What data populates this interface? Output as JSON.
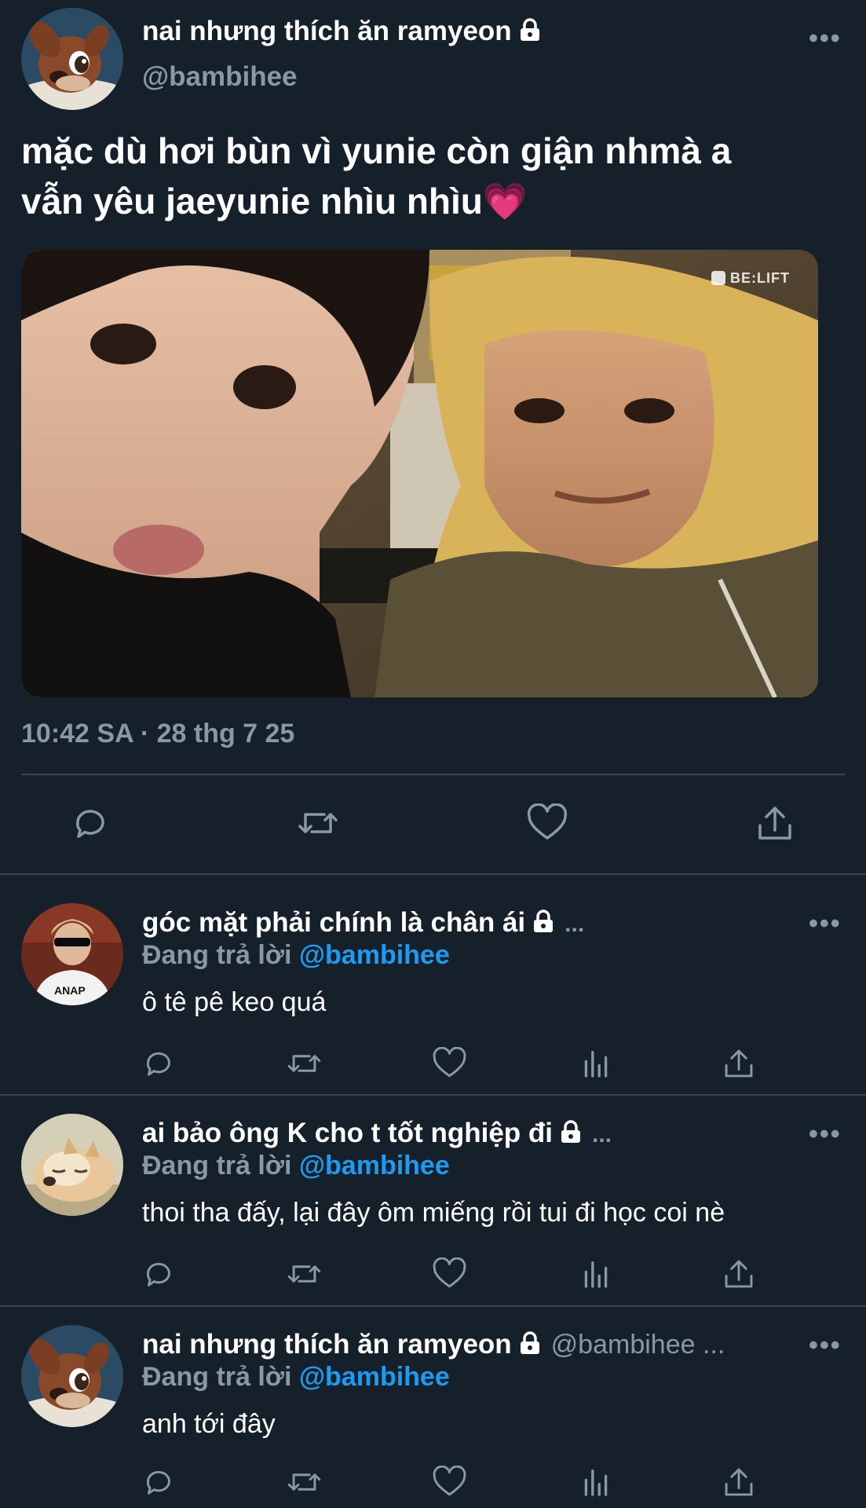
{
  "main_tweet": {
    "display_name": "nai nhưng thích ăn ramyeon",
    "handle": "@bambihee",
    "text_line1": "mặc dù hơi bùn vì yunie còn giận nhmà a",
    "text_line2": "vẫn yêu jaeyunie nhìu nhìu💗",
    "watermark": "BE:LIFT",
    "timestamp": "10:42 SA · 28 thg 7 25",
    "more": "•••"
  },
  "replies": [
    {
      "display_name": "góc mặt phải chính là chân ái",
      "ellipsis": "...",
      "replying_prefix": "Đang trả lời ",
      "replying_handle": "@bambihee",
      "text": "ô tê pê keo quá",
      "shirt_text": "ANAP",
      "more": "•••"
    },
    {
      "display_name": "ai bảo ông K cho t tốt nghiệp đi",
      "ellipsis": "...",
      "replying_prefix": "Đang trả lời ",
      "replying_handle": "@bambihee",
      "text": "thoi tha đấy, lại đây ôm miếng rồi tui đi học coi nè",
      "more": "•••"
    },
    {
      "display_name": "nai nhưng thích ăn ramyeon",
      "handle_inline": "@bambihee ...",
      "replying_prefix": "Đang trả lời ",
      "replying_handle": "@bambihee",
      "text": "anh tới đây",
      "more": "•••"
    }
  ],
  "icons": {
    "reply": "reply-icon",
    "retweet": "retweet-icon",
    "like": "heart-icon",
    "share": "share-icon",
    "views": "analytics-icon",
    "lock": "lock-icon"
  },
  "colors": {
    "background": "#15202b",
    "text": "#ffffff",
    "muted": "#8899a6",
    "link": "#1d9bf0",
    "divider": "#38444d"
  }
}
